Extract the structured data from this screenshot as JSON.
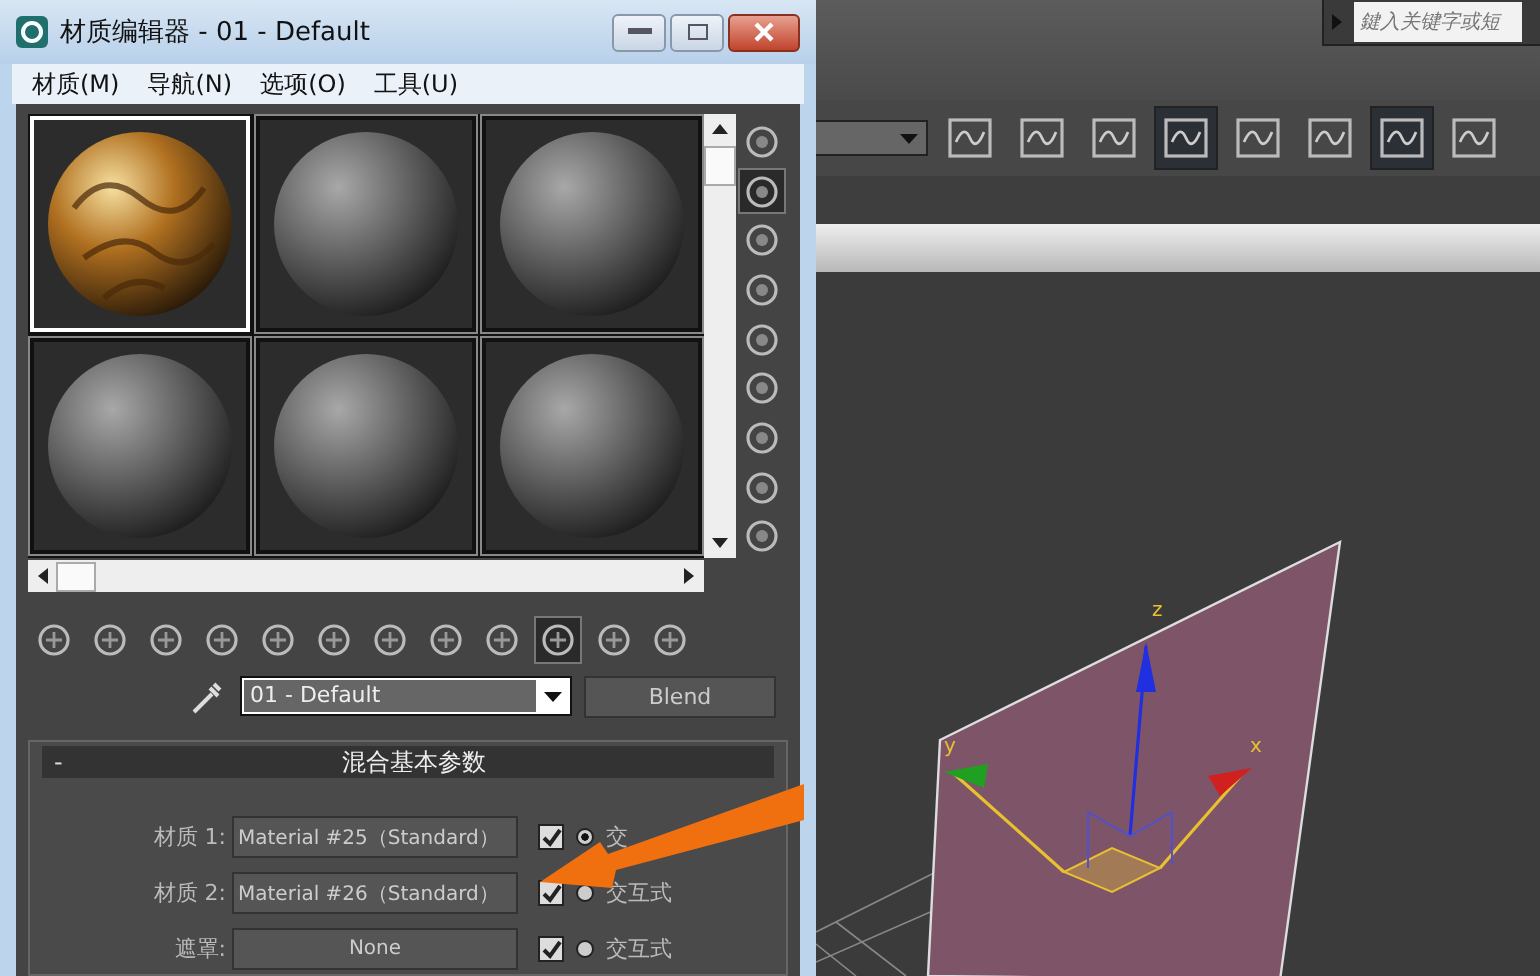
{
  "window": {
    "title": "材质编辑器 - 01 - Default"
  },
  "menu": [
    {
      "label": "材质(M)"
    },
    {
      "label": "导航(N)"
    },
    {
      "label": "选项(O)"
    },
    {
      "label": "工具(U)"
    }
  ],
  "sample_slots": [
    {
      "kind": "textured",
      "selected": true
    },
    {
      "kind": "plain",
      "selected": false
    },
    {
      "kind": "plain",
      "selected": false
    },
    {
      "kind": "plain",
      "selected": false
    },
    {
      "kind": "plain",
      "selected": false
    },
    {
      "kind": "plain",
      "selected": false
    }
  ],
  "side_toolbar": [
    {
      "selected": false
    },
    {
      "selected": true
    },
    {
      "selected": false
    },
    {
      "selected": false
    },
    {
      "selected": false
    },
    {
      "selected": false
    },
    {
      "selected": false
    },
    {
      "selected": false
    },
    {
      "selected": false
    }
  ],
  "bottom_toolbar": [
    {
      "selected": false
    },
    {
      "selected": false
    },
    {
      "selected": false
    },
    {
      "selected": false
    },
    {
      "selected": false
    },
    {
      "selected": false
    },
    {
      "selected": false
    },
    {
      "selected": false
    },
    {
      "selected": false
    },
    {
      "selected": true
    },
    {
      "selected": false
    },
    {
      "selected": false
    }
  ],
  "material": {
    "name": "01 - Default",
    "type": "Blend"
  },
  "rollout": {
    "collapse": "-",
    "title": "混合基本参数",
    "rows": [
      {
        "label": "材质 1:",
        "value": "Material #25（Standard）",
        "checked": true,
        "radio_selected": true,
        "radio_label": "交"
      },
      {
        "label": "材质 2:",
        "value": "Material #26（Standard）",
        "checked": true,
        "radio_selected": false,
        "radio_label": "交互式"
      },
      {
        "label": "遮罩:",
        "value": "None",
        "checked": true,
        "radio_selected": false,
        "radio_label": "交互式"
      }
    ]
  },
  "main_app": {
    "search": {
      "placeholder": "鍵入关键字或短"
    },
    "toolbar": [
      {
        "selected": false
      },
      {
        "selected": false
      },
      {
        "selected": false
      },
      {
        "selected": true
      },
      {
        "selected": false
      },
      {
        "selected": false
      },
      {
        "selected": true
      },
      {
        "selected": false
      }
    ],
    "viewport": {
      "axes": [
        {
          "kind": "z",
          "label": "z"
        },
        {
          "kind": "y",
          "label": "y"
        },
        {
          "kind": "x",
          "label": "x"
        }
      ]
    }
  }
}
